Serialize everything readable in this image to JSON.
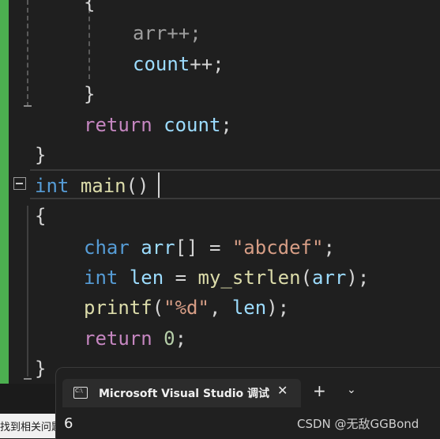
{
  "editor": {
    "lines": [
      {
        "id": "l0",
        "tokens": [
          {
            "c": "pun",
            "t": "{"
          }
        ]
      },
      {
        "id": "l1",
        "tokens": [
          {
            "c": "gray",
            "t": "arr++;"
          }
        ]
      },
      {
        "id": "l2",
        "tokens": [
          {
            "c": "var",
            "t": "count"
          },
          {
            "c": "pun",
            "t": "++;"
          }
        ]
      },
      {
        "id": "l3",
        "tokens": [
          {
            "c": "pun",
            "t": "}"
          }
        ]
      },
      {
        "id": "l4",
        "tokens": [
          {
            "c": "kwc",
            "t": "return"
          },
          {
            "c": "pun",
            "t": " "
          },
          {
            "c": "var",
            "t": "count"
          },
          {
            "c": "pun",
            "t": ";"
          }
        ]
      },
      {
        "id": "l5",
        "tokens": [
          {
            "c": "pun",
            "t": "}"
          }
        ]
      },
      {
        "id": "l6",
        "tokens": [
          {
            "c": "kw",
            "t": "int"
          },
          {
            "c": "pun",
            "t": " "
          },
          {
            "c": "fn",
            "t": "main"
          },
          {
            "c": "pun",
            "t": "()"
          }
        ]
      },
      {
        "id": "l7",
        "tokens": [
          {
            "c": "pun",
            "t": "{"
          }
        ]
      },
      {
        "id": "l8",
        "tokens": []
      },
      {
        "id": "l9",
        "tokens": [
          {
            "c": "kw",
            "t": "char"
          },
          {
            "c": "pun",
            "t": " "
          },
          {
            "c": "var",
            "t": "arr"
          },
          {
            "c": "pun",
            "t": "[] = "
          },
          {
            "c": "str",
            "t": "\"abcdef\""
          },
          {
            "c": "pun",
            "t": ";"
          }
        ]
      },
      {
        "id": "l10",
        "tokens": [
          {
            "c": "kw",
            "t": "int"
          },
          {
            "c": "pun",
            "t": " "
          },
          {
            "c": "var",
            "t": "len"
          },
          {
            "c": "pun",
            "t": " = "
          },
          {
            "c": "fn",
            "t": "my_strlen"
          },
          {
            "c": "pun",
            "t": "("
          },
          {
            "c": "var",
            "t": "arr"
          },
          {
            "c": "pun",
            "t": ");"
          }
        ]
      },
      {
        "id": "l11",
        "tokens": [
          {
            "c": "fn",
            "t": "printf"
          },
          {
            "c": "pun",
            "t": "("
          },
          {
            "c": "str",
            "t": "\"%d\""
          },
          {
            "c": "pun",
            "t": ", "
          },
          {
            "c": "var",
            "t": "len"
          },
          {
            "c": "pun",
            "t": ");"
          }
        ]
      },
      {
        "id": "l12",
        "tokens": [
          {
            "c": "kwc",
            "t": "return"
          },
          {
            "c": "pun",
            "t": " "
          },
          {
            "c": "num",
            "t": "0"
          },
          {
            "c": "pun",
            "t": ";"
          }
        ]
      },
      {
        "id": "l13",
        "tokens": [
          {
            "c": "pun",
            "t": "}"
          }
        ]
      }
    ]
  },
  "terminal": {
    "tab_title": "Microsoft Visual Studio 调试控制台",
    "close_label": "✕",
    "add_label": "+",
    "dropdown_label": "⌄",
    "output": "6"
  },
  "left_panel_text": "找到相关问题",
  "watermark": "CSDN @无敌GGBond",
  "colors": {
    "keyword": "#569cd6",
    "control_keyword": "#c586c0",
    "function": "#dcdcaa",
    "variable": "#9cdcfe",
    "string": "#d69d85",
    "number": "#b5cea8",
    "change_bar": "#4caf50"
  }
}
